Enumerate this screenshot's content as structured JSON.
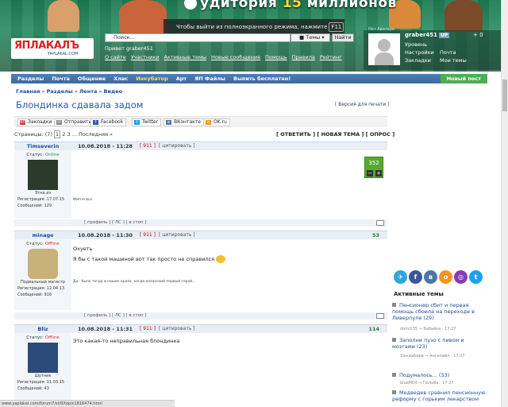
{
  "banner": {
    "headline_a": "удитория",
    "headline_num": "15",
    "headline_b": "миллионов",
    "fullscreen_tip": "Чтобы выйти из полноэкранного режима, нажмите",
    "fullscreen_key": "F11"
  },
  "logo": {
    "name": "ЯПЛАКАЛЪ",
    "sub": "YAPLAKAL.COM"
  },
  "search": {
    "placeholder": "Поиск...",
    "scope": "Темы",
    "button": "Найти"
  },
  "greeting": "Привет graber451",
  "user_links": [
    "О сайте",
    "Участники",
    "Активные темы",
    "Новые сообщения",
    "Помощь",
    "Правила",
    "Рейтинг"
  ],
  "account": {
    "label": "Нет Аватара",
    "username": "graber451",
    "badge": "UP",
    "plus": "+ 0",
    "items": [
      "Уровень",
      "Настройки",
      "Почта",
      "Закладки",
      "Мои темы"
    ]
  },
  "nav": {
    "items": [
      "Разделы",
      "Почта",
      "Общение",
      "Хлас",
      "Инкубатор",
      "Арт",
      "ЯП Файлы",
      "Выпить бесплатно!"
    ],
    "new_post": "Новый пост"
  },
  "breadcrumb": [
    "Главная",
    "Разделы",
    "Лента",
    "Видео"
  ],
  "page_title": "Блондинка сдавала задом",
  "print_version": "[ Версия для печати ]",
  "share": [
    "Закладки",
    "Отправить",
    "Facebook",
    "Twitter",
    "ВКонтакте",
    "OK.ru"
  ],
  "pager": {
    "label": "Страницы:",
    "total": "(7)",
    "current": "1",
    "pages": [
      "2",
      "3"
    ],
    "last": "... Последняя »"
  },
  "actions": "[ ОТВЕТИТЬ ] [ НОВАЯ ТЕМА ] [ ОПРОС ]",
  "posts": [
    {
      "nick": "Timseverin",
      "date": "10.08.2018 - 11:28",
      "num": "[ 911 ]",
      "quote": "[ цитировать ]",
      "status_label": "Статус:",
      "status": "Online",
      "caption": "Этна из",
      "reg": "Регистрация: 17.07.15",
      "msgs": "Сообщений: 129",
      "body": "",
      "sig": "Фигня все",
      "vote": "352"
    },
    {
      "nick": "minage",
      "date": "10.08.2018 - 11:30",
      "num": "[ 911 ]",
      "quote": "[ цитировать ]",
      "status_label": "Статус:",
      "status": "Offline",
      "caption": "Подвальный магистр",
      "reg": "Регистрация: 12.04.13",
      "msgs": "Сообщений: 916",
      "body_line1": "Охуеть",
      "body_line2": "Я бы с такой машиной вот так просто не справился",
      "sig": "Да.. было тогда в наших краях, когда казахский первый герой...",
      "score": "53"
    },
    {
      "nick": "Bliz",
      "date": "10.08.2018 - 11:31",
      "num": "[ 911 ]",
      "quote": "[ цитировать ]",
      "status_label": "Статус:",
      "status": "Offline",
      "caption": "Шутник",
      "reg": "Регистрация: 11.03.15",
      "msgs": "Сообщений: 43",
      "body": "Это какая-то неправильная блондинка",
      "score": "114"
    }
  ],
  "foot": "[ профиль ] [ ЛС ] [ в стоп ]",
  "active_topics": {
    "title": "Активные темы",
    "items": [
      {
        "t": "Пенсионер сбит и первая помощь сбоила на переходе в Ливерпуле (29)",
        "m": "dorich35 → Бабайка · 17:27"
      },
      {
        "t": "Заполни пузо с пивом и мозгами (23)",
        "m": "ЗлыдаБори → Ангелайл · 17:27"
      },
      {
        "t": "Подумалось... (33)",
        "m": "blueM04 → Гюльба · 17:27"
      },
      {
        "t": "Медведев сравнил пенсионную реформу с горьким лекарством",
        "m": ""
      }
    ]
  },
  "status_url": "www.yaplakal.com/forum7/st/0/topic1816474.html",
  "colors": {
    "nav": "#3a6aa3",
    "accent": "#2a57a4",
    "new_post": "#4caf50",
    "vote": "#5aa832"
  }
}
